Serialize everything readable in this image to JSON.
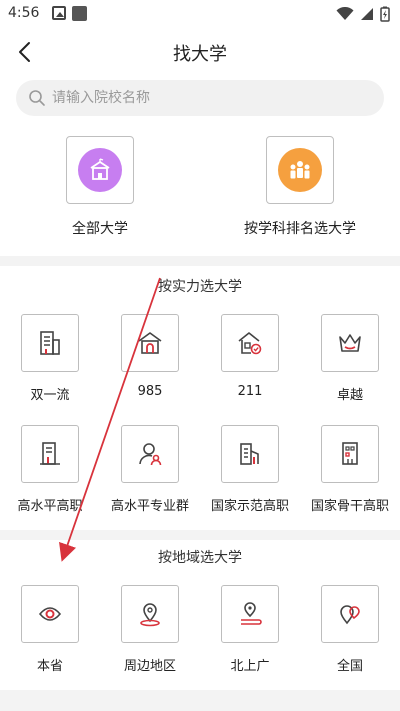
{
  "status_bar": {
    "time": "4:56"
  },
  "header": {
    "title": "找大学"
  },
  "search": {
    "placeholder": "请输入院校名称"
  },
  "top_categories": [
    {
      "label": "全部大学",
      "color": "#c77ef0"
    },
    {
      "label": "按学科排名选大学",
      "color": "#f5a03f"
    }
  ],
  "strength_section": {
    "title": "按实力选大学",
    "items": [
      {
        "label": "双一流"
      },
      {
        "label": "985"
      },
      {
        "label": "211"
      },
      {
        "label": "卓越"
      },
      {
        "label": "高水平高职"
      },
      {
        "label": "高水平专业群"
      },
      {
        "label": "国家示范高职"
      },
      {
        "label": "国家骨干高职"
      }
    ]
  },
  "region_section": {
    "title": "按地域选大学",
    "items": [
      {
        "label": "本省"
      },
      {
        "label": "周边地区"
      },
      {
        "label": "北上广"
      },
      {
        "label": "全国"
      }
    ]
  },
  "colors": {
    "accent": "#d8333c",
    "icon_dark": "#444444"
  }
}
